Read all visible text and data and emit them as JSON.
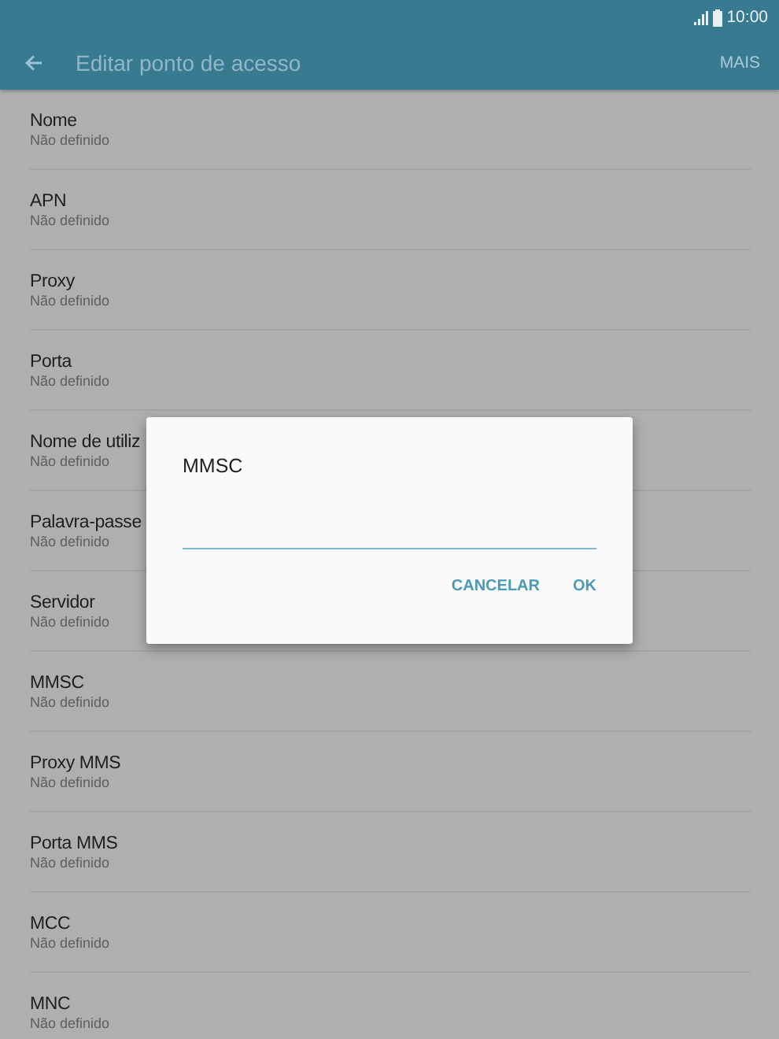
{
  "status_bar": {
    "time": "10:00"
  },
  "app_bar": {
    "title": "Editar ponto de acesso",
    "action": "MAIS"
  },
  "settings": [
    {
      "label": "Nome",
      "value": "Não definido"
    },
    {
      "label": "APN",
      "value": "Não definido"
    },
    {
      "label": "Proxy",
      "value": "Não definido"
    },
    {
      "label": "Porta",
      "value": "Não definido"
    },
    {
      "label": "Nome de utiliz",
      "value": "Não definido"
    },
    {
      "label": "Palavra-passe",
      "value": "Não definido"
    },
    {
      "label": "Servidor",
      "value": "Não definido"
    },
    {
      "label": "MMSC",
      "value": "Não definido"
    },
    {
      "label": "Proxy MMS",
      "value": "Não definido"
    },
    {
      "label": "Porta MMS",
      "value": "Não definido"
    },
    {
      "label": "MCC",
      "value": "Não definido"
    },
    {
      "label": "MNC",
      "value": "Não definido"
    }
  ],
  "dialog": {
    "title": "MMSC",
    "buttons": [
      "CANCELAR",
      "OK"
    ]
  }
}
